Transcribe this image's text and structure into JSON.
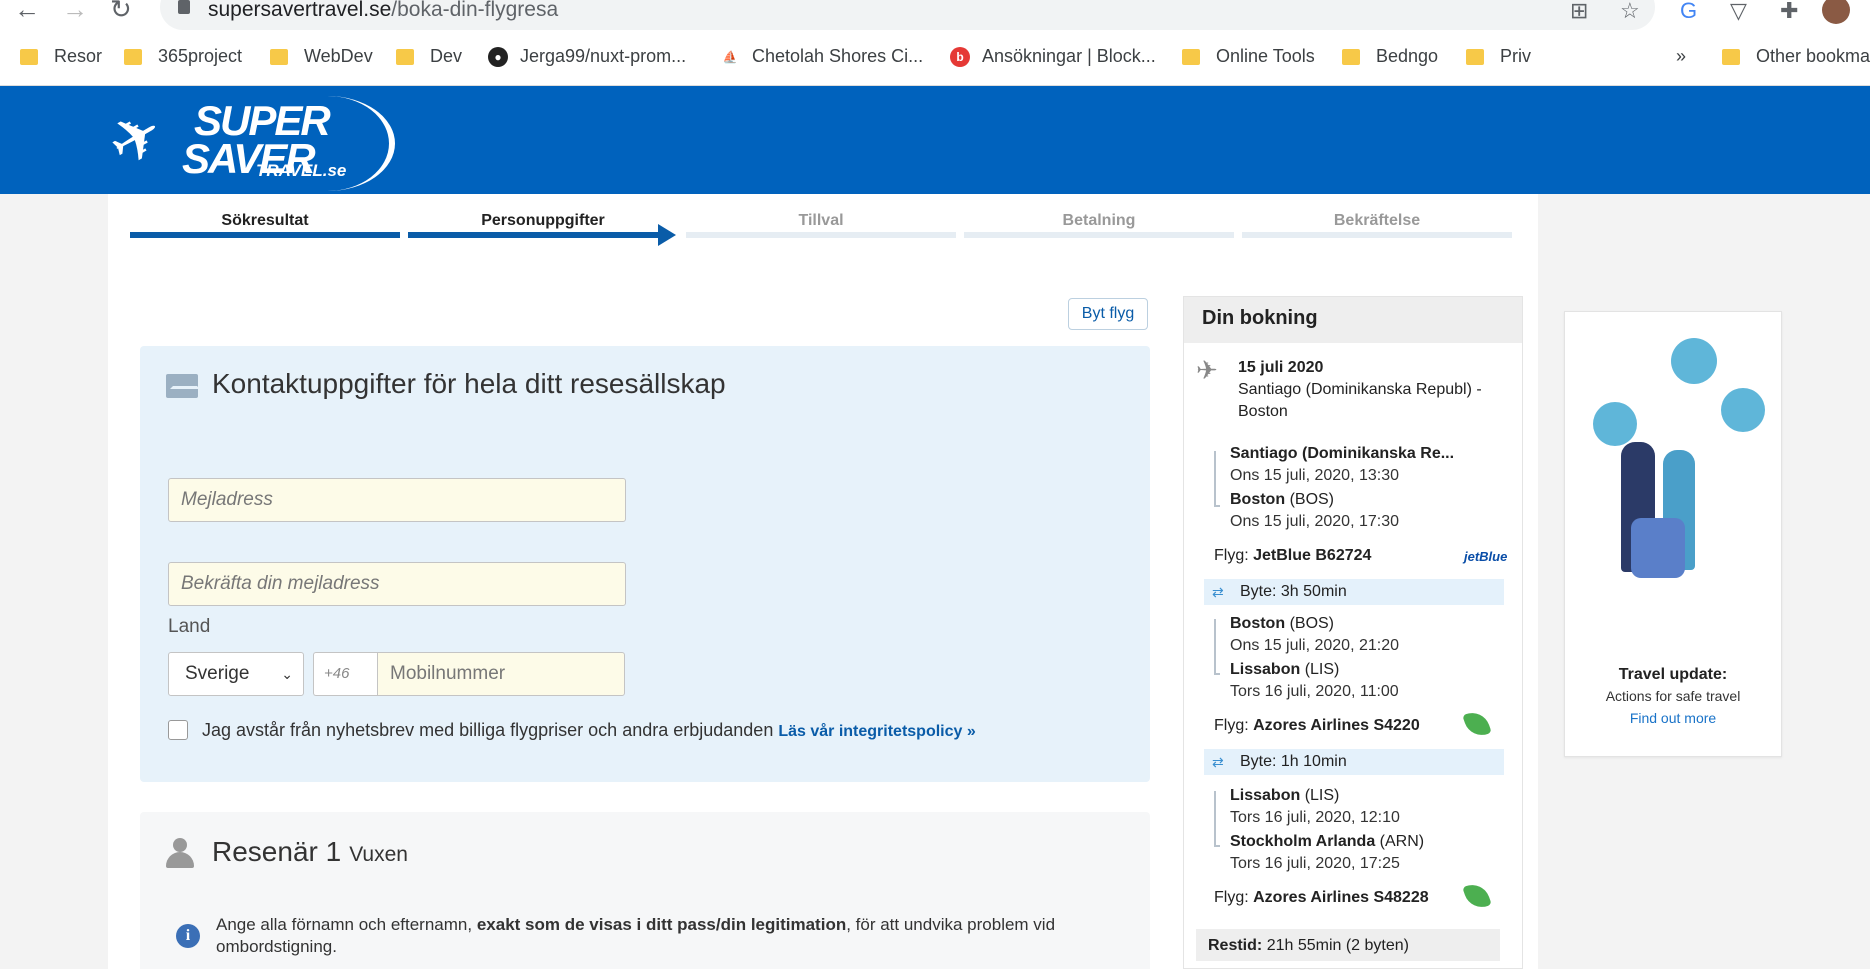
{
  "browser": {
    "url_domain": "supersavertravel.se",
    "url_path": "/boka-din-flygresa",
    "bookmarks": [
      {
        "label": "Resor",
        "icon": "folder-icon"
      },
      {
        "label": "365project",
        "icon": "folder-icon"
      },
      {
        "label": "WebDev",
        "icon": "folder-icon"
      },
      {
        "label": "Dev",
        "icon": "folder-icon"
      },
      {
        "label": "Jerga99/nuxt-prom...",
        "icon": "github-icon"
      },
      {
        "label": "Chetolah Shores Ci...",
        "icon": "sailboat-icon"
      },
      {
        "label": "Ansökningar | Block...",
        "icon": "b-badge-icon"
      },
      {
        "label": "Online Tools",
        "icon": "folder-icon"
      },
      {
        "label": "Bedngo",
        "icon": "folder-icon"
      },
      {
        "label": "Priv",
        "icon": "folder-icon"
      }
    ],
    "more_bookmarks": "»",
    "other_bookmarks": "Other bookma"
  },
  "logo": {
    "line1": "SUPER",
    "line2": "SAVER",
    "line3": "TRAVEL.se"
  },
  "steps": [
    {
      "label": "Sökresultat",
      "state": "done"
    },
    {
      "label": "Personuppgifter",
      "state": "current"
    },
    {
      "label": "Tillval",
      "state": "todo"
    },
    {
      "label": "Betalning",
      "state": "todo"
    },
    {
      "label": "Bekräftelse",
      "state": "todo"
    }
  ],
  "byt_flyg": "Byt flyg",
  "contact": {
    "title": "Kontaktuppgifter för hela ditt resesällskap",
    "email_placeholder": "Mejladress",
    "email_confirm_placeholder": "Bekräfta din mejladress",
    "country_label": "Land",
    "country_value": "Sverige",
    "phone_prefix": "+46",
    "phone_placeholder": "Mobilnummer",
    "newsletter_text": "Jag avstår från nyhetsbrev med billiga flygpriser och andra erbjudanden",
    "privacy_link": "Läs vår integritetspolicy »"
  },
  "traveler": {
    "title": "Resenär 1",
    "type": "Vuxen",
    "info_prefix": "Ange alla förnamn och efternamn, ",
    "info_bold": "exakt som de visas i ditt pass/din legitimation",
    "info_suffix": ", för att undvika problem vid ombordstigning."
  },
  "booking": {
    "title": "Din bokning",
    "date": "15 juli 2020",
    "route_line1": "Santiago (Dominikanska Republ) -",
    "route_line2": "Boston",
    "segments": [
      {
        "from": "Santiago (Dominikanska Re...",
        "from_code": "",
        "dep": "Ons 15 juli, 2020, 13:30",
        "to": "Boston",
        "to_code": "(BOS)",
        "arr": "Ons 15 juli, 2020, 17:30",
        "flight_label": "Flyg:",
        "flight": "JetBlue B62724",
        "airline_logo": "jetBlue"
      },
      {
        "from": "Boston",
        "from_code": "(BOS)",
        "dep": "Ons 15 juli, 2020, 21:20",
        "to": "Lissabon",
        "to_code": "(LIS)",
        "arr": "Tors 16 juli, 2020, 11:00",
        "flight_label": "Flyg:",
        "flight": "Azores Airlines S4220"
      },
      {
        "from": "Lissabon",
        "from_code": "(LIS)",
        "dep": "Tors 16 juli, 2020, 12:10",
        "to": "Stockholm Arlanda",
        "to_code": "(ARN)",
        "arr": "Tors 16 juli, 2020, 17:25",
        "flight_label": "Flyg:",
        "flight": "Azores Airlines S48228"
      }
    ],
    "layovers": [
      "Byte: 3h 50min",
      "Byte: 1h 10min"
    ],
    "restid_label": "Restid:",
    "restid_value": "21h 55min (2 byten)"
  },
  "promo": {
    "title": "Travel update:",
    "subtitle": "Actions for safe travel",
    "link": "Find out more"
  },
  "colors": {
    "header_blue": "#0062bd",
    "step_blue": "#0a5ca8",
    "contact_bg": "#e7f2fa",
    "input_bg": "#fdfbe8"
  }
}
